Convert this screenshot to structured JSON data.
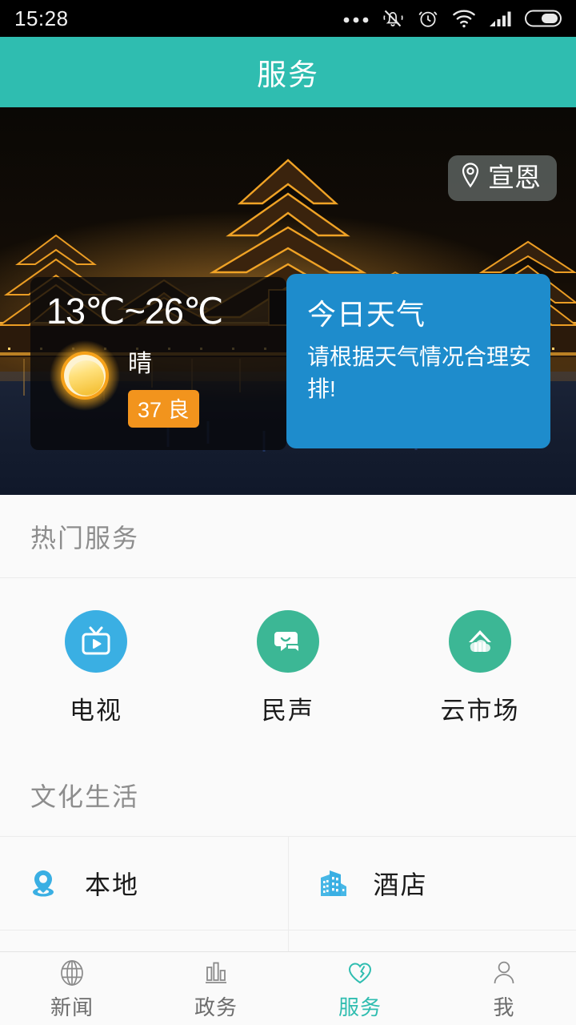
{
  "status_bar": {
    "time": "15:28",
    "icons": [
      "more-dots-icon",
      "bell-muted-icon",
      "alarm-clock-icon",
      "wifi-icon",
      "signal-bars-icon",
      "battery-icon"
    ]
  },
  "header": {
    "title": "服务",
    "accent_color": "#2fbdb0"
  },
  "hero": {
    "location_pill": {
      "label": "宣恩",
      "icon": "location-pin-icon"
    },
    "weather_card": {
      "temperature_range": "13℃~26℃",
      "condition": "晴",
      "condition_icon": "sun-icon",
      "aqi_value": "37",
      "aqi_level": "良",
      "aqi_color": "#f2941d"
    },
    "today_card": {
      "title": "今日天气",
      "description": "请根据天气情况合理安排!",
      "background_color": "#1e8ccc"
    }
  },
  "hot_services": {
    "section_title": "热门服务",
    "items": [
      {
        "label": "电视",
        "icon": "tv-icon",
        "color": "#3aafe3"
      },
      {
        "label": "民声",
        "icon": "chat-bubbles-icon",
        "color": "#3cb795"
      },
      {
        "label": "云市场",
        "icon": "cloud-market-icon",
        "color": "#3cb795"
      }
    ]
  },
  "culture_life": {
    "section_title": "文化生活",
    "items": [
      {
        "label": "本地",
        "icon": "location-pin-icon",
        "color": "#3aafe3"
      },
      {
        "label": "酒店",
        "icon": "buildings-icon",
        "color": "#3aafe3"
      },
      {
        "label": "",
        "icon": "cloud-icon",
        "color": "#3aafe3"
      },
      {
        "label": "",
        "icon": "mountains-icon",
        "color": "#3aafe3"
      }
    ]
  },
  "tab_bar": {
    "items": [
      {
        "label": "新闻",
        "icon": "globe-icon",
        "active": false
      },
      {
        "label": "政务",
        "icon": "bar-chart-icon",
        "active": false
      },
      {
        "label": "服务",
        "icon": "heart-icon",
        "active": true
      },
      {
        "label": "我",
        "icon": "person-icon",
        "active": false
      }
    ],
    "active_color": "#2fbdb0"
  }
}
